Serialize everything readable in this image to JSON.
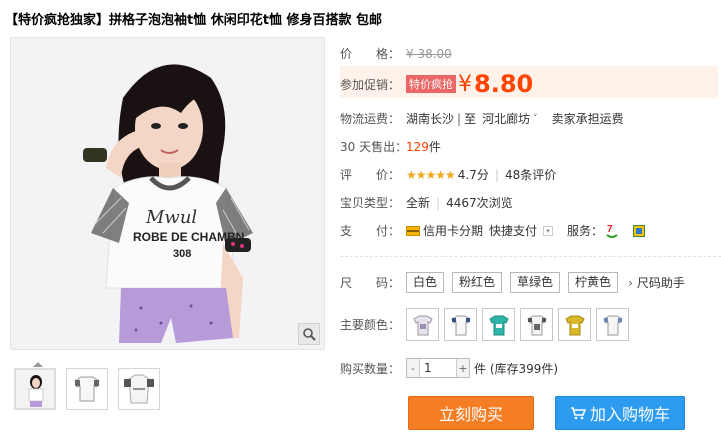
{
  "title": "【特价疯抢独家】拼格子泡泡袖t恤 休闲印花t恤 修身百搭款 包邮",
  "price": {
    "label": "价　　格：",
    "original": "¥ 38.00",
    "promo_label": "参加促销：",
    "promo_tag": "特价疯抢",
    "currency": "¥",
    "value": "8.80"
  },
  "shipping": {
    "label": "物流运费：",
    "from": "湖南长沙",
    "sep": "|",
    "to_prefix": "至",
    "to": "河北廊坊",
    "arrow": "˅",
    "note": "卖家承担运费"
  },
  "sales": {
    "label": "30 天售出：",
    "count": "129",
    "unit": "件"
  },
  "rating": {
    "label": "评　　价：",
    "stars": "★★★★★",
    "score": "4.7分",
    "sep": "|",
    "reviews": "48条评价"
  },
  "product_type": {
    "label": "宝贝类型：",
    "condition": "全新",
    "sep": "|",
    "views": "4467次浏览"
  },
  "payment": {
    "label": "支　　付：",
    "credit": "信用卡分期",
    "quick": "快捷支付",
    "service_label": "服务："
  },
  "size": {
    "label": "尺　　码：",
    "options": [
      "白色",
      "粉红色",
      "草绿色",
      "柠黄色"
    ],
    "helper": "尺码助手"
  },
  "colors": {
    "label": "主要颜色："
  },
  "quantity": {
    "label": "购买数量：",
    "minus": "-",
    "plus": "+",
    "value": "1",
    "stock": "件 (库存399件)"
  },
  "buttons": {
    "buy": "立刻购买",
    "cart": "加入购物车"
  },
  "shirt_text": {
    "line1": "Mwul",
    "line2": "ROBE DE CHAMBN",
    "line3": "308"
  }
}
